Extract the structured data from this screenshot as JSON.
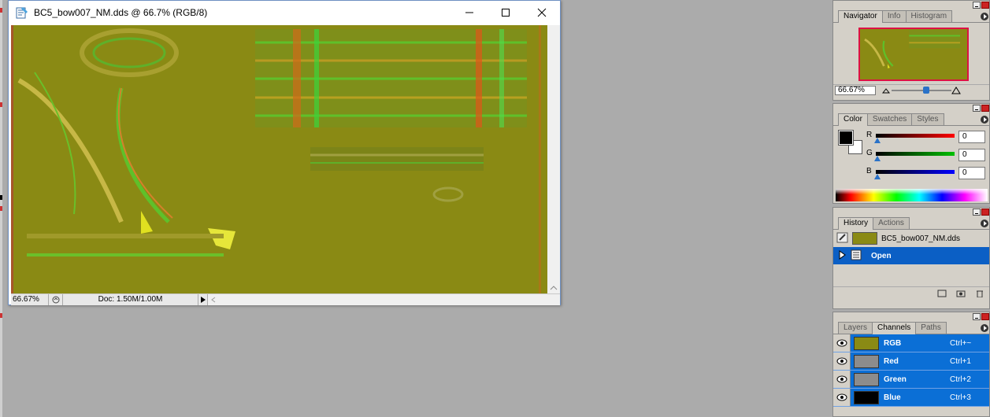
{
  "document": {
    "title": "BC5_bow007_NM.dds @ 66.7% (RGB/8)",
    "status_zoom": "66.67%",
    "status_doc": "Doc: 1.50M/1.00M"
  },
  "navigator": {
    "tabs": [
      "Navigator",
      "Info",
      "Histogram"
    ],
    "zoom": "66.67%",
    "zoom_level": 0.5
  },
  "color": {
    "tabs": [
      "Color",
      "Swatches",
      "Styles"
    ],
    "channels": [
      {
        "label": "R",
        "value": "0",
        "gradient_to": "#ff0000"
      },
      {
        "label": "G",
        "value": "0",
        "gradient_to": "#00c000"
      },
      {
        "label": "B",
        "value": "0",
        "gradient_to": "#0000ff"
      }
    ],
    "foreground": "#000000",
    "background": "#ffffff"
  },
  "history": {
    "tabs": [
      "History",
      "Actions"
    ],
    "snapshot": "BC5_bow007_NM.dds",
    "items": [
      "Open"
    ]
  },
  "channels": {
    "tabs": [
      "Layers",
      "Channels",
      "Paths"
    ],
    "rows": [
      {
        "name": "RGB",
        "shortcut": "Ctrl+~",
        "thumb": "#8a8a14"
      },
      {
        "name": "Red",
        "shortcut": "Ctrl+1",
        "thumb": "#8c8c8c"
      },
      {
        "name": "Green",
        "shortcut": "Ctrl+2",
        "thumb": "#8c8c8c"
      },
      {
        "name": "Blue",
        "shortcut": "Ctrl+3",
        "thumb": "#000000"
      }
    ]
  },
  "colors": {
    "selection": "#0b6fd6",
    "normal_map": "#8a8a14"
  }
}
